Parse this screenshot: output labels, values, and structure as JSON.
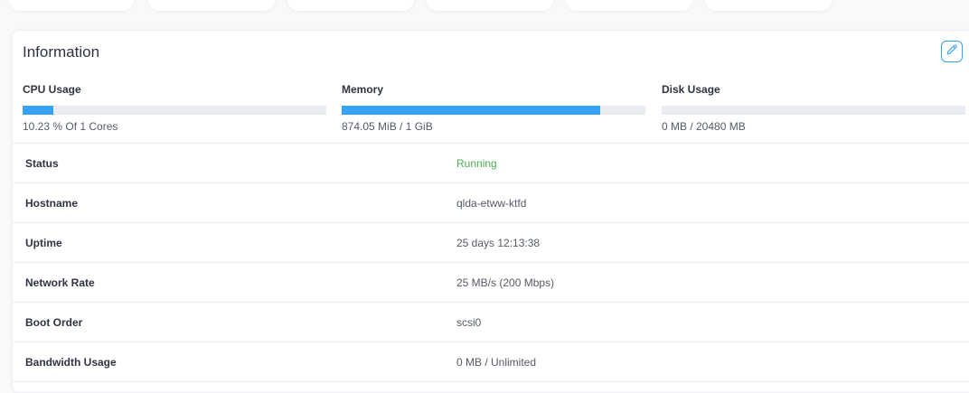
{
  "info": {
    "title": "Information",
    "edit_icon": "pencil-icon"
  },
  "usage": [
    {
      "label": "CPU Usage",
      "value": "10.23 % Of 1 Cores",
      "fill_pct": 10
    },
    {
      "label": "Memory",
      "value": "874.05 MiB / 1 GiB",
      "fill_pct": 85
    },
    {
      "label": "Disk Usage",
      "value": "0 MB / 20480 MB",
      "fill_pct": 0
    }
  ],
  "details": [
    {
      "label": "Status",
      "value": "Running",
      "color": "#4caf50"
    },
    {
      "label": "Hostname",
      "value": "qlda-etww-ktfd"
    },
    {
      "label": "Uptime",
      "value": "25 days 12:13:38"
    },
    {
      "label": "Network Rate",
      "value": "25 MB/s (200 Mbps)"
    },
    {
      "label": "Boot Order",
      "value": "scsi0"
    },
    {
      "label": "Bandwidth Usage",
      "value": "0 MB / Unlimited"
    }
  ],
  "colors": {
    "accent": "#36a3f7",
    "running": "#4caf50"
  }
}
